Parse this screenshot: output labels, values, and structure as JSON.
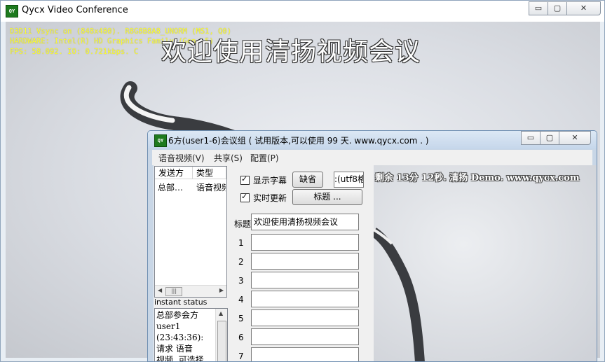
{
  "main_window": {
    "title": "Qycx Video Conference",
    "icon": "qycx-app-icon",
    "controls": {
      "minimize": "▭",
      "maximize": "▢",
      "close": "✕"
    }
  },
  "video": {
    "osd_line1": "D3D11 Vsync on (848x480). R8G8B8A8_UNORM (MS1, Q0)",
    "osd_line2": "HARDWARE: Intel(R) HD Graphics Family (Gen. 5)",
    "osd_line3": "FPS: 58.092. IO: 0.721kbps. C",
    "caption": "欢迎使用清扬视频会议"
  },
  "dialog": {
    "title": "6方(user1-6)会议组 ( 试用版本,可以使用 99 天. www.qycx.com . )",
    "menu": [
      "语音视频(V)",
      "共享(S)",
      "配置(P)"
    ],
    "message_list": {
      "columns": [
        "发送方",
        "类型"
      ],
      "rows": [
        [
          "总部…",
          "语音视频"
        ]
      ]
    },
    "scroll_thumb": "|||",
    "status_label": "instant status",
    "status_text": "总部参会方\nuser1\n(23:43:36):\n  请求 语音\n  视频, 可选择",
    "subtitle_checkbox": "显示字幕",
    "realtime_checkbox": "实时更新",
    "default_button": "缺省",
    "encoding_field": ":(utf8格",
    "title_button": "标题 ...",
    "title_label": "标题",
    "title_value": "欢迎使用清扬视频会议",
    "line_labels": [
      "1",
      "2",
      "3",
      "4",
      "5",
      "6",
      "7"
    ],
    "overlay_text": "剩余 13分 12秒. 清扬 Demo. www.qycx.com",
    "controls": {
      "minimize": "▭",
      "maximize": "▢",
      "close": "✕"
    }
  }
}
